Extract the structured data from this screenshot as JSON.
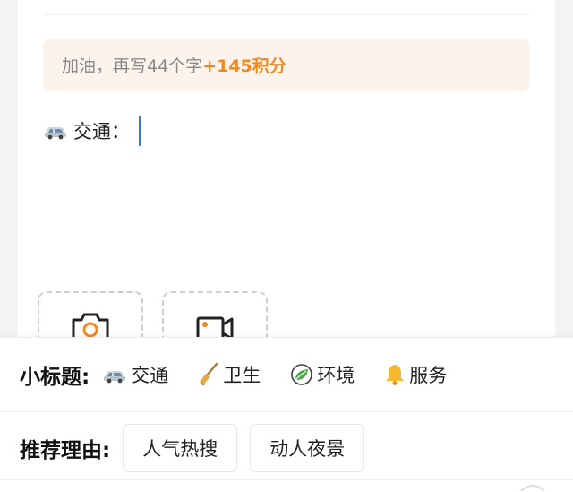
{
  "editor": {
    "tip_prefix": "加油，再写44个字",
    "tip_highlight": "+145积分",
    "line_label": "交通：",
    "line_icon": "car-icon",
    "accent_color": "#f08a1c",
    "cursor_color": "#1f7fe0"
  },
  "uploads": [
    {
      "type": "photo",
      "icon": "camera-icon"
    },
    {
      "type": "video",
      "icon": "video-camera-icon"
    }
  ],
  "subtitle": {
    "label": "小标题:",
    "tags": [
      {
        "icon": "car-icon",
        "label": "交通"
      },
      {
        "icon": "broom-icon",
        "label": "卫生"
      },
      {
        "icon": "leaf-icon",
        "label": "环境"
      },
      {
        "icon": "bell-icon",
        "label": "服务"
      }
    ]
  },
  "reason": {
    "label": "推荐理由:",
    "chips": [
      "人气热搜",
      "动人夜景"
    ]
  }
}
